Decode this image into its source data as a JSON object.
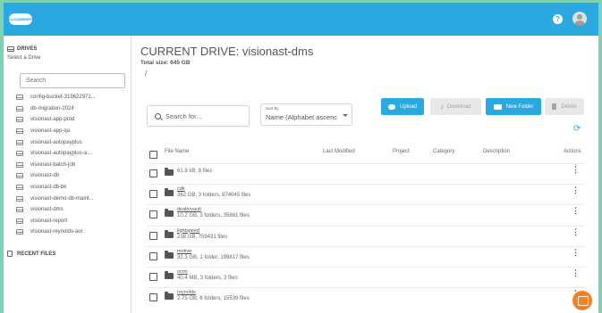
{
  "app": {
    "logo_text": "CLOUDBERRY",
    "help_label": "?"
  },
  "sidebar": {
    "drives_title": "DRIVES",
    "select_label": "Select a Drive",
    "search_placeholder": "Search",
    "drives": [
      "config-bucket-319622971...",
      "db-migration-2024",
      "visionast-app-prod",
      "visionast-app-qa",
      "visionast-autopayplus",
      "visionast-autopayplus-a...",
      "visionast-batch-job",
      "visionast-db",
      "visionast-db-bk",
      "visionast-demo-db-maint...",
      "visionast-dms",
      "visionast-report",
      "visionast-reynolds-aoi"
    ],
    "recent_files_label": "RECENT FILES"
  },
  "main": {
    "title": "CURRENT DRIVE: visionast-dms",
    "total_size": "Total size: 645 GB",
    "path": "/",
    "search_placeholder": "Search for...",
    "sort_label": "Sort By",
    "sort_value": "Name (Alphabet ascenc",
    "buttons": {
      "upload": "Upload",
      "download": "Download",
      "new_folder": "New Folder",
      "delete": "Delete"
    },
    "columns": [
      "File Name",
      "Last Modified",
      "Project",
      "Category",
      "Description",
      "Actions"
    ],
    "rows": [
      {
        "name": "",
        "info": "61.9 kB, 8 files"
      },
      {
        "name": "cdk",
        "info": "362 GB, 3 folders, 874045 files"
      },
      {
        "name": "dealervault",
        "info": "10.2 GB, 3 folders, 35861 files"
      },
      {
        "name": "lightspeed",
        "info": "238 GB, 759431 files"
      },
      {
        "name": "motive",
        "info": "32.3 GB, 1 folder, 199817 files"
      },
      {
        "name": "ocmi",
        "info": "40.4 MB, 3 folders, 3 files"
      },
      {
        "name": "reynolds",
        "info": "2.75 GB, 6 folders, 15539 files"
      }
    ]
  },
  "colors": {
    "accent": "#29a9e0",
    "chat": "#f58220",
    "background": "#7fd1b3"
  }
}
